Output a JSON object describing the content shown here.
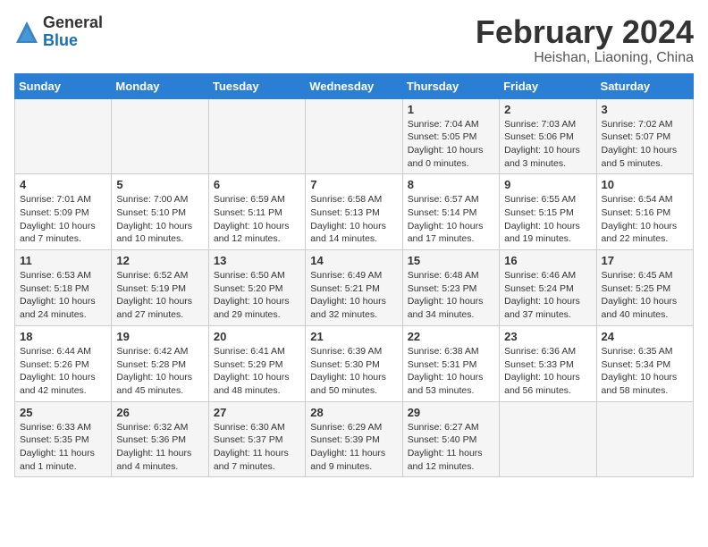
{
  "header": {
    "logo_general": "General",
    "logo_blue": "Blue",
    "month_title": "February 2024",
    "subtitle": "Heishan, Liaoning, China"
  },
  "calendar": {
    "weekdays": [
      "Sunday",
      "Monday",
      "Tuesday",
      "Wednesday",
      "Thursday",
      "Friday",
      "Saturday"
    ],
    "weeks": [
      [
        {
          "day": "",
          "info": ""
        },
        {
          "day": "",
          "info": ""
        },
        {
          "day": "",
          "info": ""
        },
        {
          "day": "",
          "info": ""
        },
        {
          "day": "1",
          "info": "Sunrise: 7:04 AM\nSunset: 5:05 PM\nDaylight: 10 hours\nand 0 minutes."
        },
        {
          "day": "2",
          "info": "Sunrise: 7:03 AM\nSunset: 5:06 PM\nDaylight: 10 hours\nand 3 minutes."
        },
        {
          "day": "3",
          "info": "Sunrise: 7:02 AM\nSunset: 5:07 PM\nDaylight: 10 hours\nand 5 minutes."
        }
      ],
      [
        {
          "day": "4",
          "info": "Sunrise: 7:01 AM\nSunset: 5:09 PM\nDaylight: 10 hours\nand 7 minutes."
        },
        {
          "day": "5",
          "info": "Sunrise: 7:00 AM\nSunset: 5:10 PM\nDaylight: 10 hours\nand 10 minutes."
        },
        {
          "day": "6",
          "info": "Sunrise: 6:59 AM\nSunset: 5:11 PM\nDaylight: 10 hours\nand 12 minutes."
        },
        {
          "day": "7",
          "info": "Sunrise: 6:58 AM\nSunset: 5:13 PM\nDaylight: 10 hours\nand 14 minutes."
        },
        {
          "day": "8",
          "info": "Sunrise: 6:57 AM\nSunset: 5:14 PM\nDaylight: 10 hours\nand 17 minutes."
        },
        {
          "day": "9",
          "info": "Sunrise: 6:55 AM\nSunset: 5:15 PM\nDaylight: 10 hours\nand 19 minutes."
        },
        {
          "day": "10",
          "info": "Sunrise: 6:54 AM\nSunset: 5:16 PM\nDaylight: 10 hours\nand 22 minutes."
        }
      ],
      [
        {
          "day": "11",
          "info": "Sunrise: 6:53 AM\nSunset: 5:18 PM\nDaylight: 10 hours\nand 24 minutes."
        },
        {
          "day": "12",
          "info": "Sunrise: 6:52 AM\nSunset: 5:19 PM\nDaylight: 10 hours\nand 27 minutes."
        },
        {
          "day": "13",
          "info": "Sunrise: 6:50 AM\nSunset: 5:20 PM\nDaylight: 10 hours\nand 29 minutes."
        },
        {
          "day": "14",
          "info": "Sunrise: 6:49 AM\nSunset: 5:21 PM\nDaylight: 10 hours\nand 32 minutes."
        },
        {
          "day": "15",
          "info": "Sunrise: 6:48 AM\nSunset: 5:23 PM\nDaylight: 10 hours\nand 34 minutes."
        },
        {
          "day": "16",
          "info": "Sunrise: 6:46 AM\nSunset: 5:24 PM\nDaylight: 10 hours\nand 37 minutes."
        },
        {
          "day": "17",
          "info": "Sunrise: 6:45 AM\nSunset: 5:25 PM\nDaylight: 10 hours\nand 40 minutes."
        }
      ],
      [
        {
          "day": "18",
          "info": "Sunrise: 6:44 AM\nSunset: 5:26 PM\nDaylight: 10 hours\nand 42 minutes."
        },
        {
          "day": "19",
          "info": "Sunrise: 6:42 AM\nSunset: 5:28 PM\nDaylight: 10 hours\nand 45 minutes."
        },
        {
          "day": "20",
          "info": "Sunrise: 6:41 AM\nSunset: 5:29 PM\nDaylight: 10 hours\nand 48 minutes."
        },
        {
          "day": "21",
          "info": "Sunrise: 6:39 AM\nSunset: 5:30 PM\nDaylight: 10 hours\nand 50 minutes."
        },
        {
          "day": "22",
          "info": "Sunrise: 6:38 AM\nSunset: 5:31 PM\nDaylight: 10 hours\nand 53 minutes."
        },
        {
          "day": "23",
          "info": "Sunrise: 6:36 AM\nSunset: 5:33 PM\nDaylight: 10 hours\nand 56 minutes."
        },
        {
          "day": "24",
          "info": "Sunrise: 6:35 AM\nSunset: 5:34 PM\nDaylight: 10 hours\nand 58 minutes."
        }
      ],
      [
        {
          "day": "25",
          "info": "Sunrise: 6:33 AM\nSunset: 5:35 PM\nDaylight: 11 hours\nand 1 minute."
        },
        {
          "day": "26",
          "info": "Sunrise: 6:32 AM\nSunset: 5:36 PM\nDaylight: 11 hours\nand 4 minutes."
        },
        {
          "day": "27",
          "info": "Sunrise: 6:30 AM\nSunset: 5:37 PM\nDaylight: 11 hours\nand 7 minutes."
        },
        {
          "day": "28",
          "info": "Sunrise: 6:29 AM\nSunset: 5:39 PM\nDaylight: 11 hours\nand 9 minutes."
        },
        {
          "day": "29",
          "info": "Sunrise: 6:27 AM\nSunset: 5:40 PM\nDaylight: 11 hours\nand 12 minutes."
        },
        {
          "day": "",
          "info": ""
        },
        {
          "day": "",
          "info": ""
        }
      ]
    ]
  }
}
